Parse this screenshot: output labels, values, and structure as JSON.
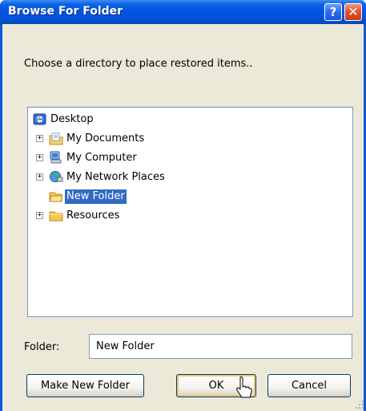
{
  "window": {
    "title": "Browse For Folder",
    "help_glyph": "?",
    "close_glyph": "✕"
  },
  "prompt": "Choose a directory to place restored items..",
  "tree": {
    "items": [
      {
        "label": "Desktop",
        "icon": "desktop-icon",
        "expandable": false,
        "selected": false
      },
      {
        "label": "My Documents",
        "icon": "documents-folder-icon",
        "expandable": true,
        "selected": false
      },
      {
        "label": "My Computer",
        "icon": "computer-icon",
        "expandable": true,
        "selected": false
      },
      {
        "label": "My Network Places",
        "icon": "network-places-icon",
        "expandable": true,
        "selected": false
      },
      {
        "label": "New Folder",
        "icon": "folder-open-icon",
        "expandable": false,
        "selected": true
      },
      {
        "label": "Resources",
        "icon": "folder-icon",
        "expandable": true,
        "selected": false
      }
    ],
    "expander_glyph": "+"
  },
  "folder": {
    "label": "Folder:",
    "value": "New Folder"
  },
  "buttons": {
    "make_new_folder": "Make New Folder",
    "ok": "OK",
    "cancel": "Cancel"
  },
  "colors": {
    "title_bar": "#0055e3",
    "selection": "#316ac5",
    "dialog_face": "#ece9d8",
    "close_button": "#e0552d"
  }
}
